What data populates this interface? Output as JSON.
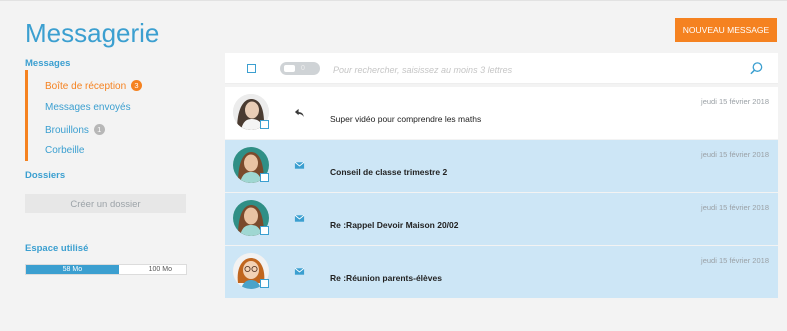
{
  "header": {
    "title": "Messagerie",
    "new_message_label": "NOUVEAU MESSAGE"
  },
  "sidebar": {
    "messages_heading": "Messages",
    "items": [
      {
        "label": "Boîte de réception",
        "badge": "3",
        "active": true
      },
      {
        "label": "Messages envoyés",
        "badge": "",
        "active": false
      },
      {
        "label": "Brouillons",
        "badge": "1",
        "active": false
      },
      {
        "label": "Corbeille",
        "badge": "",
        "active": false
      }
    ],
    "folders_heading": "Dossiers",
    "create_folder_label": "Créer un dossier",
    "storage_heading": "Espace utilisé",
    "storage_used_label": "58 Mo",
    "storage_total_label": "100 Mo",
    "storage_fraction": 0.58
  },
  "toolbar": {
    "toggle_label": "0",
    "search_placeholder": "Pour rechercher, saisissez au moins 3 lettres"
  },
  "messages": [
    {
      "sender": "",
      "subject": "Super vidéo pour comprendre les maths",
      "date": "jeudi 15 février 2018",
      "status": "replied",
      "unread": false
    },
    {
      "sender": "",
      "subject": "Conseil de classe trimestre 2",
      "date": "jeudi 15 février 2018",
      "status": "unread",
      "unread": true
    },
    {
      "sender": "",
      "subject": "Re :Rappel Devoir Maison 20/02",
      "date": "jeudi 15 février 2018",
      "status": "unread",
      "unread": true
    },
    {
      "sender": "",
      "subject": "Re :Réunion parents-élèves",
      "date": "jeudi 15 février 2018",
      "status": "unread",
      "unread": true
    }
  ],
  "colors": {
    "accent": "#f58220",
    "primary": "#3b9fd0",
    "unread_bg": "#cde6f6"
  },
  "icons": {
    "replied": "reply-icon",
    "unread": "envelope-icon",
    "search": "search-icon"
  }
}
